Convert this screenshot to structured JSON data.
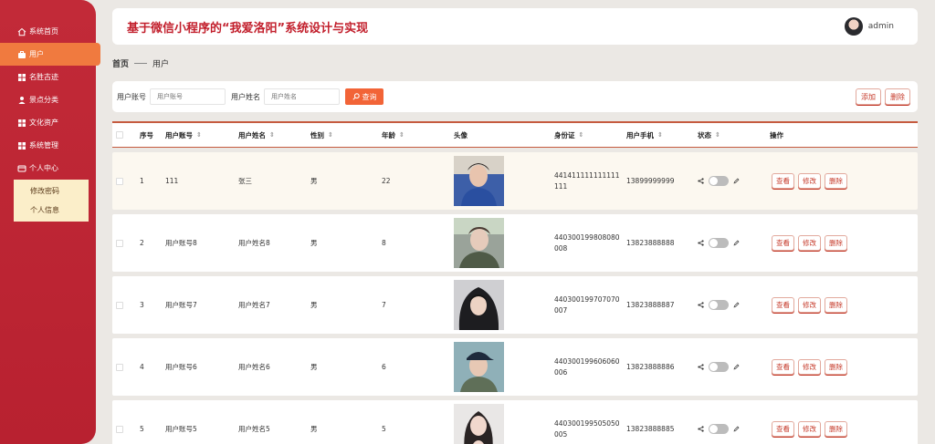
{
  "sidebar": {
    "items": [
      {
        "label": "系统首页",
        "icon": "home-icon"
      },
      {
        "label": "用户",
        "icon": "briefcase-icon"
      },
      {
        "label": "名胜古迹",
        "icon": "grid-icon"
      },
      {
        "label": "景点分类",
        "icon": "person-icon"
      },
      {
        "label": "文化资产",
        "icon": "grid-icon"
      },
      {
        "label": "系统管理",
        "icon": "grid-icon"
      },
      {
        "label": "个人中心",
        "icon": "card-icon"
      }
    ],
    "submenu": [
      {
        "label": "修改密码"
      },
      {
        "label": "个人信息"
      }
    ]
  },
  "header": {
    "title": "基于微信小程序的“我爱洛阳”系统设计与实现",
    "username": "admin"
  },
  "breadcrumb": {
    "home": "首页",
    "current": "用户"
  },
  "search": {
    "account_label": "用户账号",
    "account_placeholder": "用户账号",
    "name_label": "用户姓名",
    "name_placeholder": "用户姓名",
    "search_btn": "查询",
    "add_btn": "添加",
    "delete_btn": "删除"
  },
  "table": {
    "headers": {
      "index": "序号",
      "account": "用户账号",
      "name": "用户姓名",
      "gender": "性别",
      "age": "年龄",
      "avatar": "头像",
      "id_card": "身份证",
      "phone": "用户手机",
      "status": "状态",
      "actions": "操作"
    },
    "row_actions": {
      "view": "查看",
      "edit": "修改",
      "delete": "删除"
    },
    "rows": [
      {
        "index": "1",
        "account": "111",
        "name": "张三",
        "gender": "男",
        "age": "22",
        "id_card": "441411111111111111",
        "phone": "13899999999",
        "photo": "male-blue"
      },
      {
        "index": "2",
        "account": "用户账号8",
        "name": "用户姓名8",
        "gender": "男",
        "age": "8",
        "id_card": "440300199808080008",
        "phone": "13823888888",
        "photo": "male-outdoor"
      },
      {
        "index": "3",
        "account": "用户账号7",
        "name": "用户姓名7",
        "gender": "男",
        "age": "7",
        "id_card": "440300199707070007",
        "phone": "13823888887",
        "photo": "male-hood"
      },
      {
        "index": "4",
        "account": "用户账号6",
        "name": "用户姓名6",
        "gender": "男",
        "age": "6",
        "id_card": "440300199606060006",
        "phone": "13823888886",
        "photo": "male-cap"
      },
      {
        "index": "5",
        "account": "用户账号5",
        "name": "用户姓名5",
        "gender": "男",
        "age": "5",
        "id_card": "440300199505050005",
        "phone": "13823888885",
        "photo": "female"
      }
    ]
  },
  "colors": {
    "accent": "#c21f2c",
    "sidebar": "#bf2635",
    "active": "#f07a3f",
    "button": "#f26437"
  }
}
